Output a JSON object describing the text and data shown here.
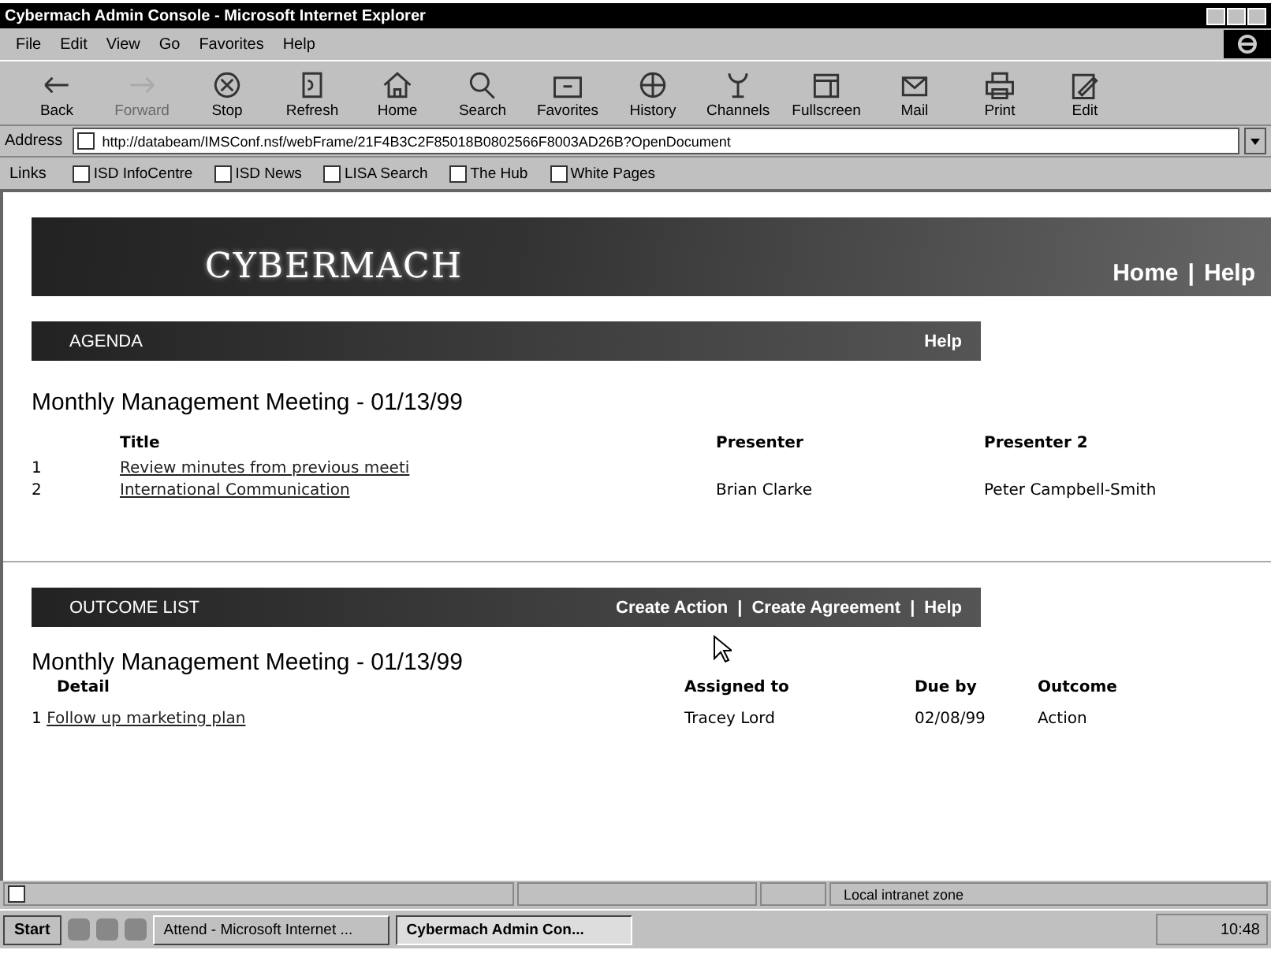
{
  "window": {
    "title": "Cybermach Admin Console - Microsoft Internet Explorer"
  },
  "menu": [
    "File",
    "Edit",
    "View",
    "Go",
    "Favorites",
    "Help"
  ],
  "toolbar": [
    {
      "label": "Back",
      "disabled": false
    },
    {
      "label": "Forward",
      "disabled": true
    },
    {
      "label": "Stop",
      "disabled": false
    },
    {
      "label": "Refresh",
      "disabled": false
    },
    {
      "label": "Home",
      "disabled": false
    },
    {
      "label": "Search",
      "disabled": false
    },
    {
      "label": "Favorites",
      "disabled": false
    },
    {
      "label": "History",
      "disabled": false
    },
    {
      "label": "Channels",
      "disabled": false
    },
    {
      "label": "Fullscreen",
      "disabled": false
    },
    {
      "label": "Mail",
      "disabled": false
    },
    {
      "label": "Print",
      "disabled": false
    },
    {
      "label": "Edit",
      "disabled": false
    }
  ],
  "address": {
    "label": "Address",
    "value": "http://databeam/IMSConf.nsf/webFrame/21F4B3C2F85018B0802566F8003AD26B?OpenDocument"
  },
  "links": {
    "label": "Links",
    "items": [
      "ISD InfoCentre",
      "ISD News",
      "LISA Search",
      "The Hub",
      "White Pages"
    ]
  },
  "banner": {
    "logo": "CYBERMACH",
    "links": [
      "Home",
      "Help"
    ],
    "separator": "|"
  },
  "agenda": {
    "heading": "AGENDA",
    "actions": [
      "Help"
    ],
    "meeting": "Monthly Management Meeting - 01/13/99",
    "columns": [
      "Title",
      "Presenter",
      "Presenter 2"
    ],
    "rows": [
      {
        "number": "1",
        "title": "Review minutes from previous meeti",
        "presenter": "",
        "presenter2": ""
      },
      {
        "number": "2",
        "title": "International Communication",
        "presenter": "Brian Clarke",
        "presenter2": "Peter Campbell-Smith"
      }
    ]
  },
  "outcomes": {
    "heading": "OUTCOME LIST",
    "actions": [
      "Create Action",
      "Create Agreement",
      "Help"
    ],
    "separator": "|",
    "meeting": "Monthly Management Meeting - 01/13/99",
    "columns": [
      "Detail",
      "Assigned to",
      "Due by",
      "Outcome"
    ],
    "rows": [
      {
        "number": "1",
        "detail": "Follow up marketing plan",
        "assigned": "Tracey Lord",
        "due": "02/08/99",
        "outcome": "Action"
      }
    ]
  },
  "status_bar": {
    "zone": "Local intranet zone"
  },
  "taskbar": {
    "start": "Start",
    "tasks": [
      {
        "label": "Attend - Microsoft Internet ...",
        "selected": false
      },
      {
        "label": "Cybermach Admin Con...",
        "selected": true
      }
    ],
    "clock": "10:48"
  }
}
